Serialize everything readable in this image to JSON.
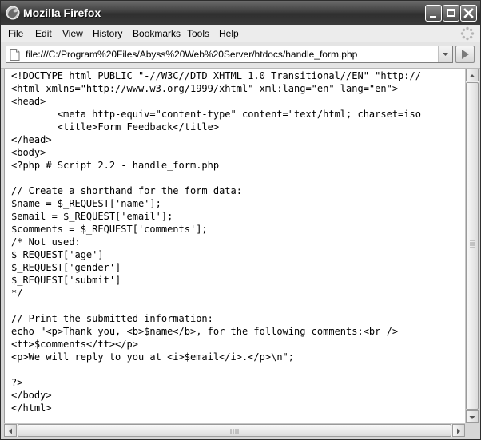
{
  "window": {
    "title": "Mozilla Firefox"
  },
  "menu": {
    "items": [
      {
        "label": "File",
        "accel": "F",
        "rest": "ile"
      },
      {
        "label": "Edit",
        "accel": "E",
        "rest": "dit"
      },
      {
        "label": "View",
        "accel": "V",
        "rest": "iew"
      },
      {
        "label": "History",
        "accel": "",
        "pre": "Hi",
        "accel2": "s",
        "rest": "tory"
      },
      {
        "label": "Bookmarks",
        "accel": "B",
        "rest": "ookmarks"
      },
      {
        "label": "Tools",
        "accel": "T",
        "rest": "ools"
      },
      {
        "label": "Help",
        "accel": "H",
        "rest": "elp"
      }
    ]
  },
  "address": {
    "url": "file:///C:/Program%20Files/Abyss%20Web%20Server/htdocs/handle_form.php"
  },
  "content": {
    "source_lines": [
      "<!DOCTYPE html PUBLIC \"-//W3C//DTD XHTML 1.0 Transitional//EN\" \"http://",
      "<html xmlns=\"http://www.w3.org/1999/xhtml\" xml:lang=\"en\" lang=\"en\">",
      "<head>",
      "        <meta http-equiv=\"content-type\" content=\"text/html; charset=iso",
      "        <title>Form Feedback</title>",
      "</head>",
      "<body>",
      "<?php # Script 2.2 - handle_form.php",
      "",
      "// Create a shorthand for the form data:",
      "$name = $_REQUEST['name'];",
      "$email = $_REQUEST['email'];",
      "$comments = $_REQUEST['comments'];",
      "/* Not used:",
      "$_REQUEST['age']",
      "$_REQUEST['gender']",
      "$_REQUEST['submit']",
      "*/",
      "",
      "// Print the submitted information:",
      "echo \"<p>Thank you, <b>$name</b>, for the following comments:<br />",
      "<tt>$comments</tt></p>",
      "<p>We will reply to you at <i>$email</i>.</p>\\n\";",
      "",
      "?>",
      "</body>",
      "</html>"
    ]
  },
  "icons": {
    "title": "firefox-icon",
    "minimize": "minimize-icon",
    "maximize": "maximize-icon",
    "close": "close-icon",
    "throbber": "throbber-icon",
    "page": "page-icon",
    "dropdown": "chevron-down-icon",
    "go": "go-arrow-icon"
  }
}
